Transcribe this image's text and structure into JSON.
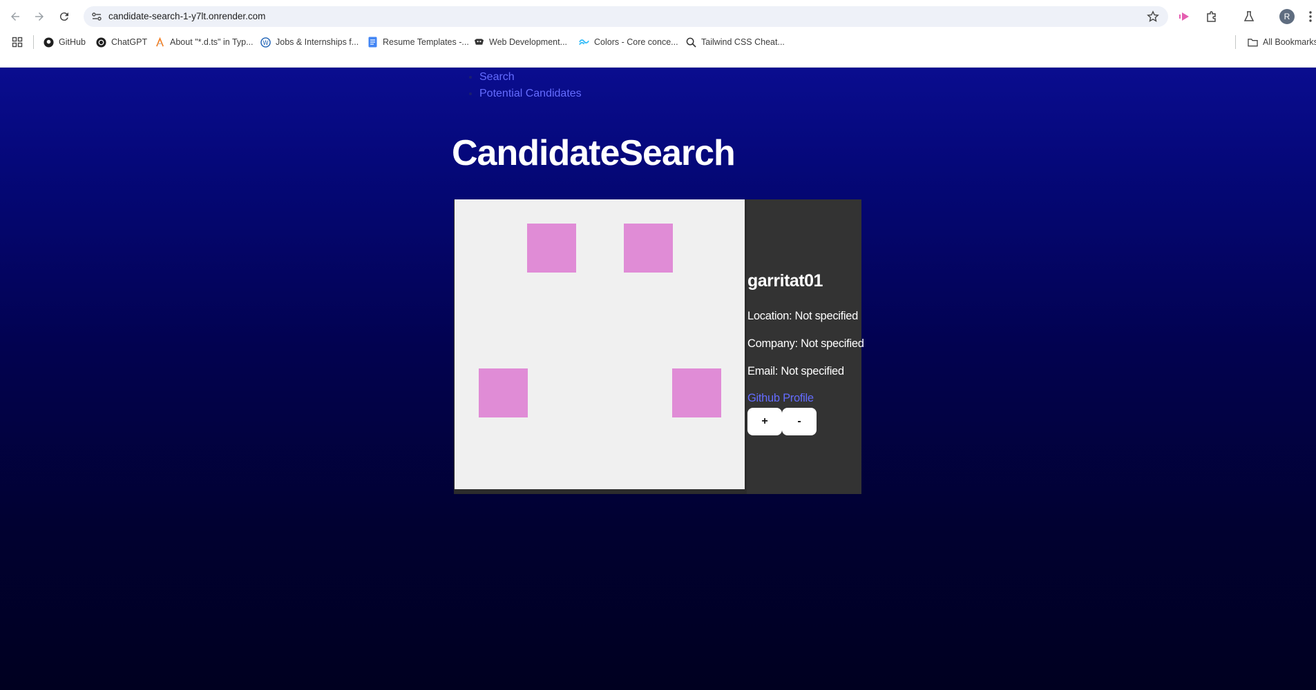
{
  "browser": {
    "url": "candidate-search-1-y7lt.onrender.com",
    "avatar_letter": "R",
    "bookmarks": [
      {
        "label": "GitHub",
        "icon": "github-icon"
      },
      {
        "label": "ChatGPT",
        "icon": "chatgpt-icon"
      },
      {
        "label": "About \"*.d.ts\" in Typ...",
        "icon": "typescript-icon"
      },
      {
        "label": "Jobs & Internships f...",
        "icon": "jobs-icon"
      },
      {
        "label": "Resume Templates -...",
        "icon": "docs-icon"
      },
      {
        "label": "Web Development...",
        "icon": "webdev-icon"
      },
      {
        "label": "Colors - Core conce...",
        "icon": "tailwind-icon"
      },
      {
        "label": "Tailwind CSS Cheat...",
        "icon": "search-icon"
      }
    ],
    "all_bookmarks_label": "All Bookmarks"
  },
  "nav": {
    "items": [
      "Search",
      "Potential Candidates"
    ]
  },
  "page_title": "CandidateSearch",
  "candidate": {
    "username": "garritat01",
    "location": "Location: Not specified",
    "company": "Company: Not specified",
    "email": "Email: Not specified",
    "profile_link": "Github Profile",
    "add_label": "+",
    "reject_label": "-",
    "identicon_color": "#e08cd6",
    "identicon_bg": "#f0f0f0"
  },
  "colors": {
    "link": "#646cff",
    "card_bg": "#333333"
  }
}
